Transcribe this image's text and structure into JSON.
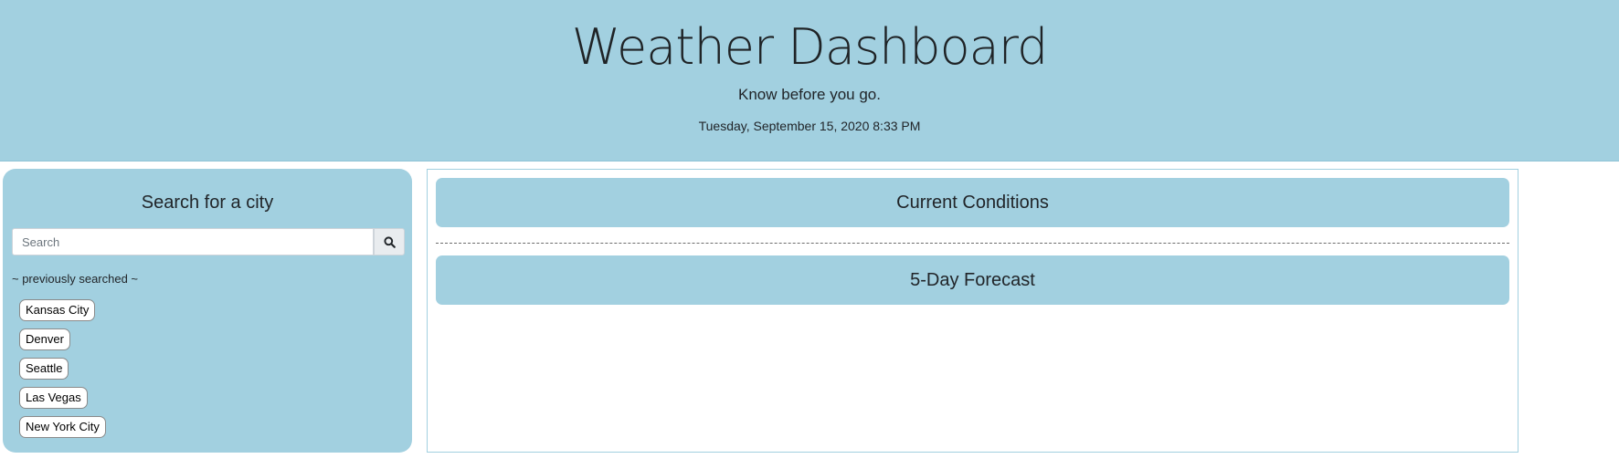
{
  "header": {
    "title": "Weather Dashboard",
    "tagline": "Know before you go.",
    "datetime": "Tuesday, September 15, 2020 8:33 PM"
  },
  "sidebar": {
    "title": "Search for a city",
    "search": {
      "placeholder": "Search",
      "value": "",
      "button_icon": "search-icon"
    },
    "previously_label": "~ previously searched ~",
    "cities": [
      "Kansas City",
      "Denver",
      "Seattle",
      "Las Vegas",
      "New York City"
    ]
  },
  "main": {
    "current_title": "Current Conditions",
    "forecast_title": "5-Day Forecast"
  },
  "colors": {
    "accent": "#a2d0e0",
    "text": "#212529"
  }
}
